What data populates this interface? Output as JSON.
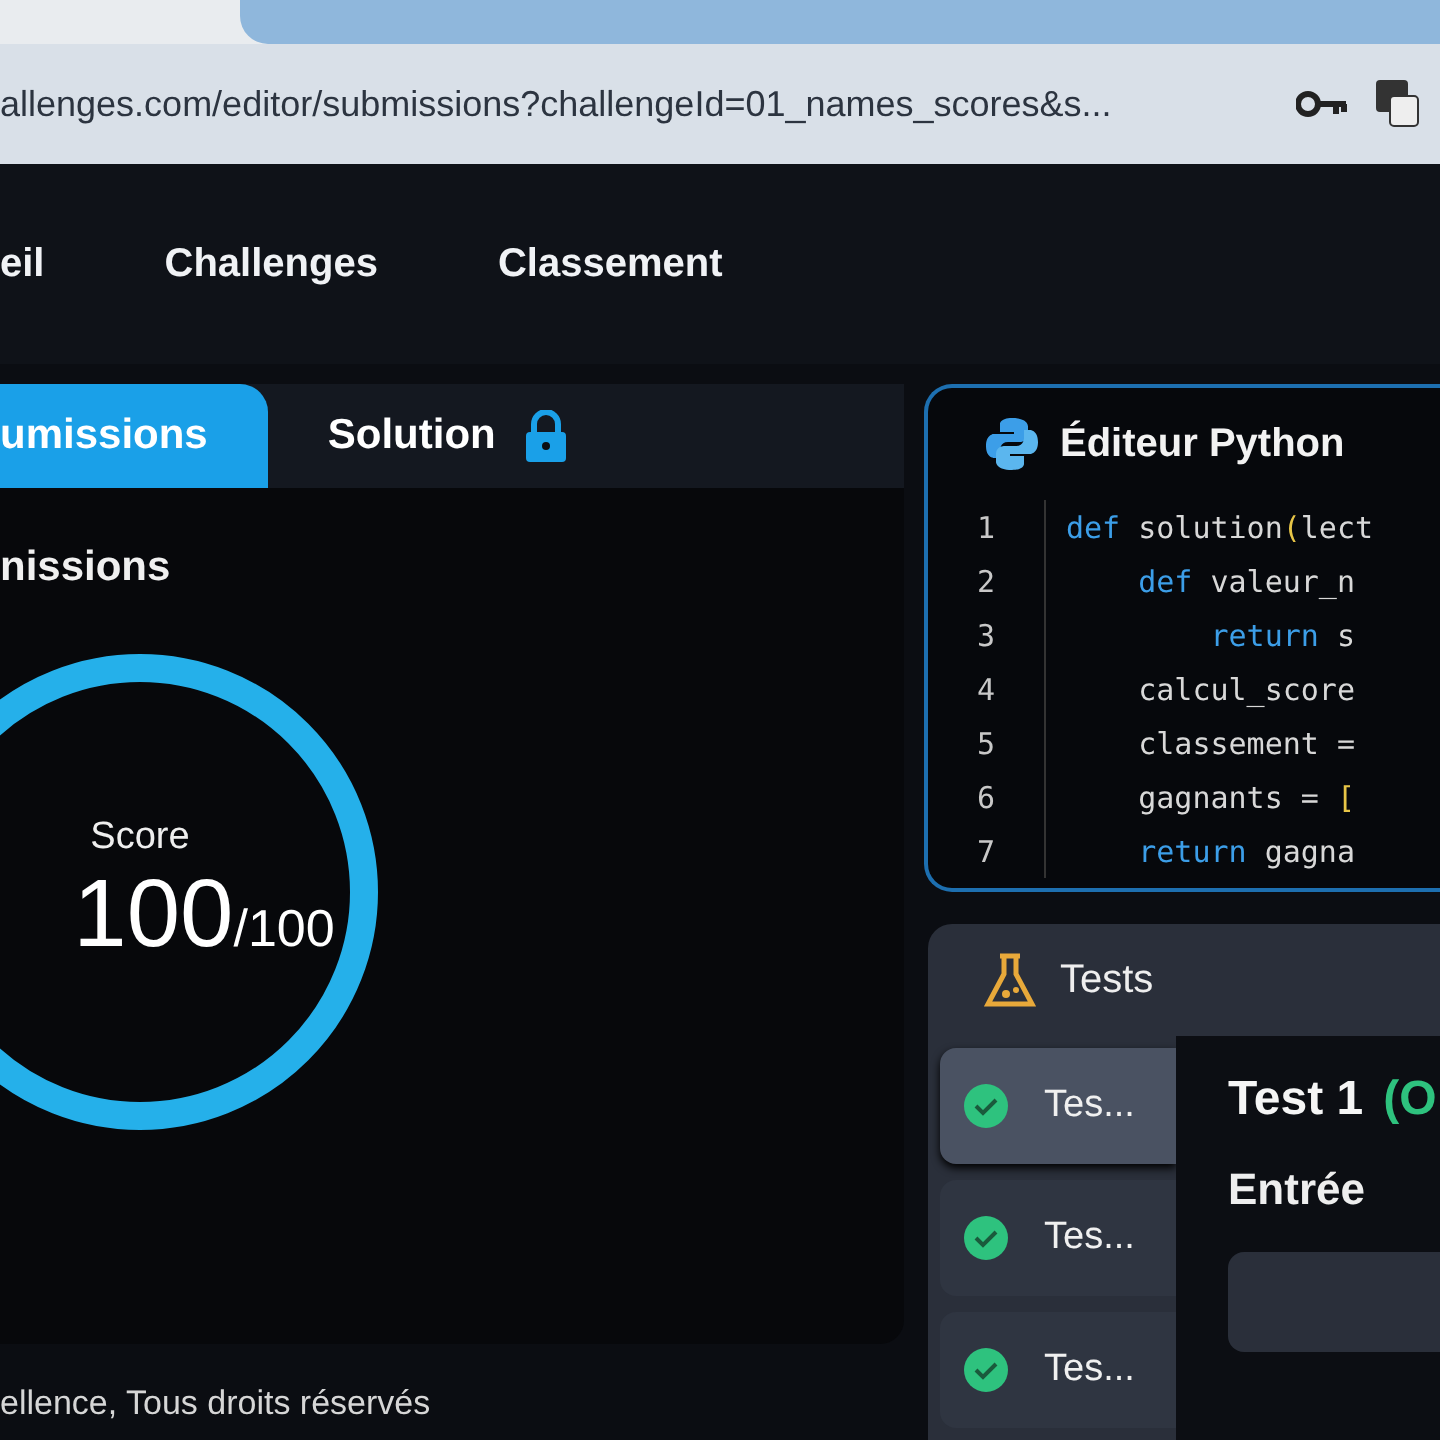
{
  "browser": {
    "url": "allenges.com/editor/submissions?challengeId=01_names_scores&s..."
  },
  "nav": {
    "items": [
      "eil",
      "Challenges",
      "Classement"
    ]
  },
  "tabs": [
    {
      "label": "umissions",
      "selected": true,
      "locked": false
    },
    {
      "label": "Solution",
      "selected": false,
      "locked": true
    }
  ],
  "submissions": {
    "title": "nissions",
    "score": {
      "label": "Score",
      "value": "100",
      "total": "/100"
    }
  },
  "footer": "ellence, Tous droits réservés",
  "editor": {
    "title": "Éditeur Python",
    "lines": [
      {
        "number": "1",
        "tokens": [
          {
            "kind": "kw",
            "text": "def"
          },
          {
            "kind": "plain",
            "text": " solution"
          },
          {
            "kind": "bracket",
            "text": "("
          },
          {
            "kind": "plain",
            "text": "lect"
          }
        ]
      },
      {
        "number": "2",
        "tokens": [
          {
            "kind": "kw",
            "text": "    def"
          },
          {
            "kind": "plain",
            "text": " valeur_n"
          }
        ]
      },
      {
        "number": "3",
        "tokens": [
          {
            "kind": "kw",
            "text": "        return"
          },
          {
            "kind": "plain",
            "text": " s"
          }
        ]
      },
      {
        "number": "4",
        "tokens": [
          {
            "kind": "plain",
            "text": "    calcul_score"
          }
        ]
      },
      {
        "number": "5",
        "tokens": [
          {
            "kind": "plain",
            "text": "    classement ="
          }
        ]
      },
      {
        "number": "6",
        "tokens": [
          {
            "kind": "plain",
            "text": "    gagnants = "
          },
          {
            "kind": "bracket",
            "text": "["
          }
        ]
      },
      {
        "number": "7",
        "tokens": [
          {
            "kind": "kw",
            "text": "    return"
          },
          {
            "kind": "plain",
            "text": " gagna"
          }
        ]
      }
    ]
  },
  "tests": {
    "title": "Tests",
    "items": [
      {
        "label": "Tes...",
        "passed": true,
        "selected": true
      },
      {
        "label": "Tes...",
        "passed": true,
        "selected": false
      },
      {
        "label": "Tes...",
        "passed": true,
        "selected": false
      }
    ],
    "detail": {
      "name": "Test 1",
      "status": "(O",
      "input_label": "Entrée"
    }
  }
}
